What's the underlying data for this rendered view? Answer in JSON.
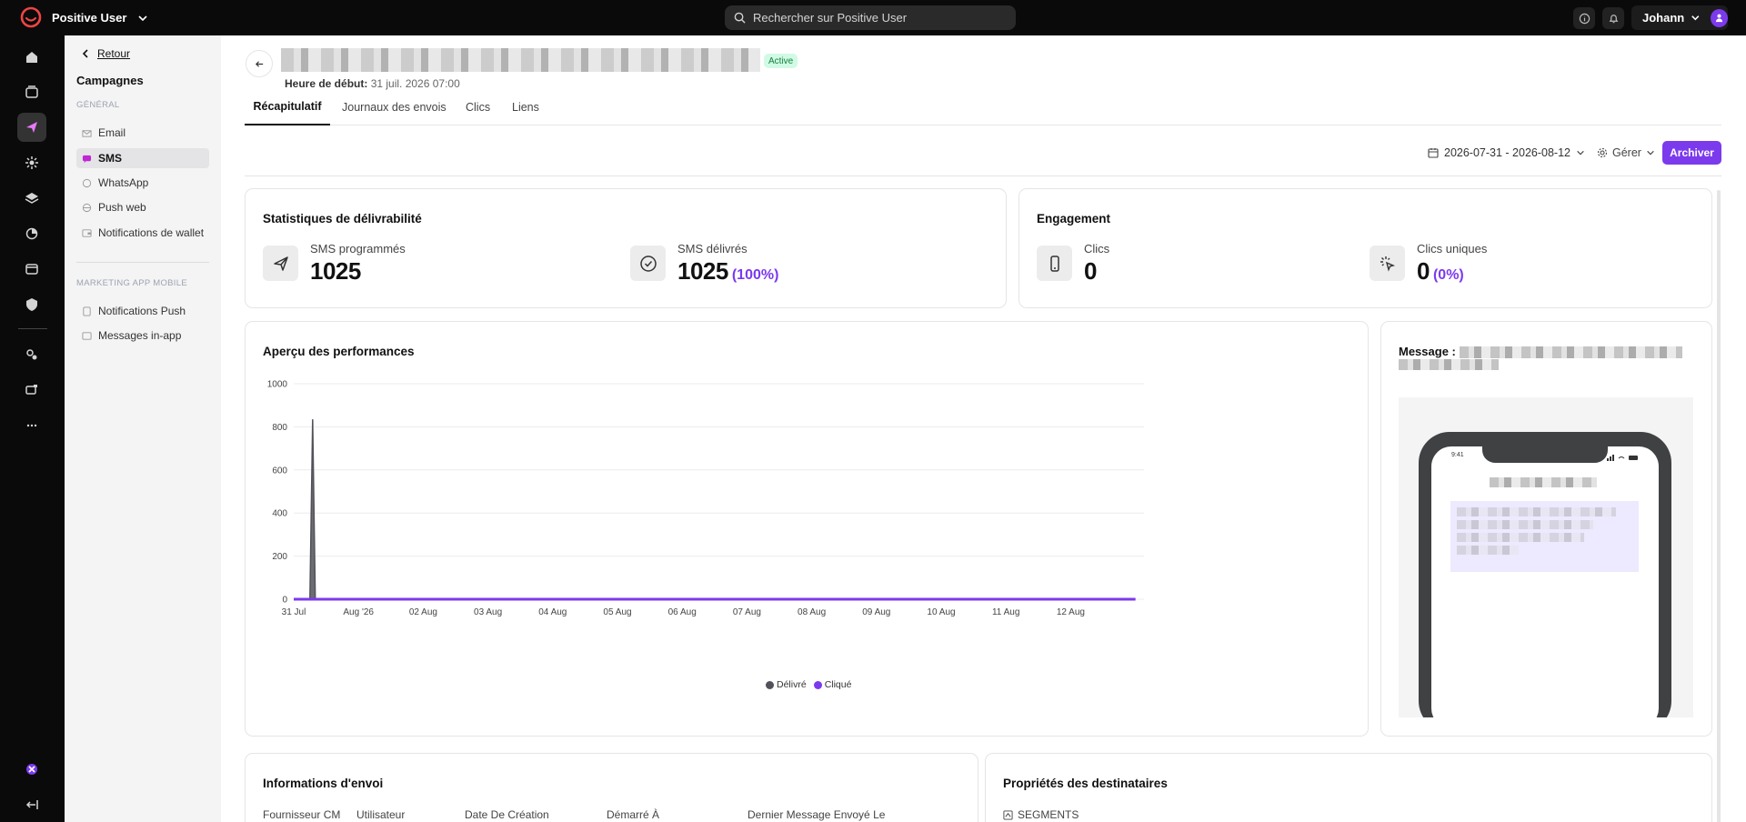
{
  "topbar": {
    "workspace": "Positive User",
    "search_placeholder": "Rechercher sur Positive User",
    "user_name": "Johann"
  },
  "subnav": {
    "back_label": "Retour",
    "title": "Campagnes",
    "section_general": "GÉNÉRAL",
    "items_general": [
      {
        "label": "Email",
        "icon": "email-icon"
      },
      {
        "label": "SMS",
        "icon": "sms-icon",
        "active": true
      },
      {
        "label": "WhatsApp",
        "icon": "whatsapp-icon"
      },
      {
        "label": "Push web",
        "icon": "push-web-icon"
      },
      {
        "label": "Notifications de wallet",
        "icon": "wallet-icon"
      }
    ],
    "section_mobile": "MARKETING APP MOBILE",
    "items_mobile": [
      {
        "label": "Notifications Push",
        "icon": "push-icon"
      },
      {
        "label": "Messages in-app",
        "icon": "in-app-icon"
      }
    ]
  },
  "campaign": {
    "status": "Active",
    "start_label": "Heure de début:",
    "start_value": "31 juil. 2026 07:00"
  },
  "tabs": [
    "Récapitulatif",
    "Journaux des envois",
    "Clics",
    "Liens"
  ],
  "toolbar": {
    "date_range": "2026-07-31 - 2026-08-12",
    "manage_label": "Gérer",
    "archive_label": "Archiver"
  },
  "deliverability": {
    "title": "Statistiques de délivrabilité",
    "scheduled_label": "SMS programmés",
    "scheduled_value": "1025",
    "delivered_label": "SMS délivrés",
    "delivered_value": "1025",
    "delivered_pct": "(100%)"
  },
  "engagement": {
    "title": "Engagement",
    "clicks_label": "Clics",
    "clicks_value": "0",
    "unique_label": "Clics uniques",
    "unique_value": "0",
    "unique_pct": "(0%)"
  },
  "performance": {
    "title": "Aperçu des performances"
  },
  "chart_data": {
    "type": "area",
    "x": [
      "31 Jul",
      "Aug '26",
      "02 Aug",
      "03 Aug",
      "04 Aug",
      "05 Aug",
      "06 Aug",
      "07 Aug",
      "08 Aug",
      "09 Aug",
      "10 Aug",
      "11 Aug",
      "12 Aug"
    ],
    "ylim": [
      0,
      1000
    ],
    "yticks": [
      0,
      200,
      400,
      600,
      800,
      1000
    ],
    "grid": true,
    "legend_placement": "bottom-center",
    "series": [
      {
        "name": "Délivré",
        "color": "#52525b",
        "points": [
          {
            "x": "31 Jul 00:00",
            "y": 0
          },
          {
            "x": "31 Jul 06:00",
            "y": 0
          },
          {
            "x": "31 Jul 07:00",
            "y": 835
          },
          {
            "x": "31 Jul 08:00",
            "y": 0
          },
          {
            "x": "12 Aug 23:59",
            "y": 0
          }
        ]
      },
      {
        "name": "Cliqué",
        "color": "#7c3aed",
        "points": [
          {
            "x": "31 Jul 00:00",
            "y": 0
          },
          {
            "x": "12 Aug 23:59",
            "y": 0
          }
        ]
      }
    ]
  },
  "message": {
    "title": "Message :",
    "phone_time": "9:41"
  },
  "send_info": {
    "title": "Informations d'envoi",
    "columns": [
      "Fournisseur CM",
      "Utilisateur",
      "Date De Création",
      "Démarré À",
      "Dernier Message Envoyé Le"
    ]
  },
  "recipients": {
    "title": "Propriétés des destinataires",
    "segments_label": "SEGMENTS"
  },
  "colors": {
    "accent": "#7c3aed",
    "active_badge_bg": "#d1fae5",
    "active_badge_text": "#15803d"
  }
}
